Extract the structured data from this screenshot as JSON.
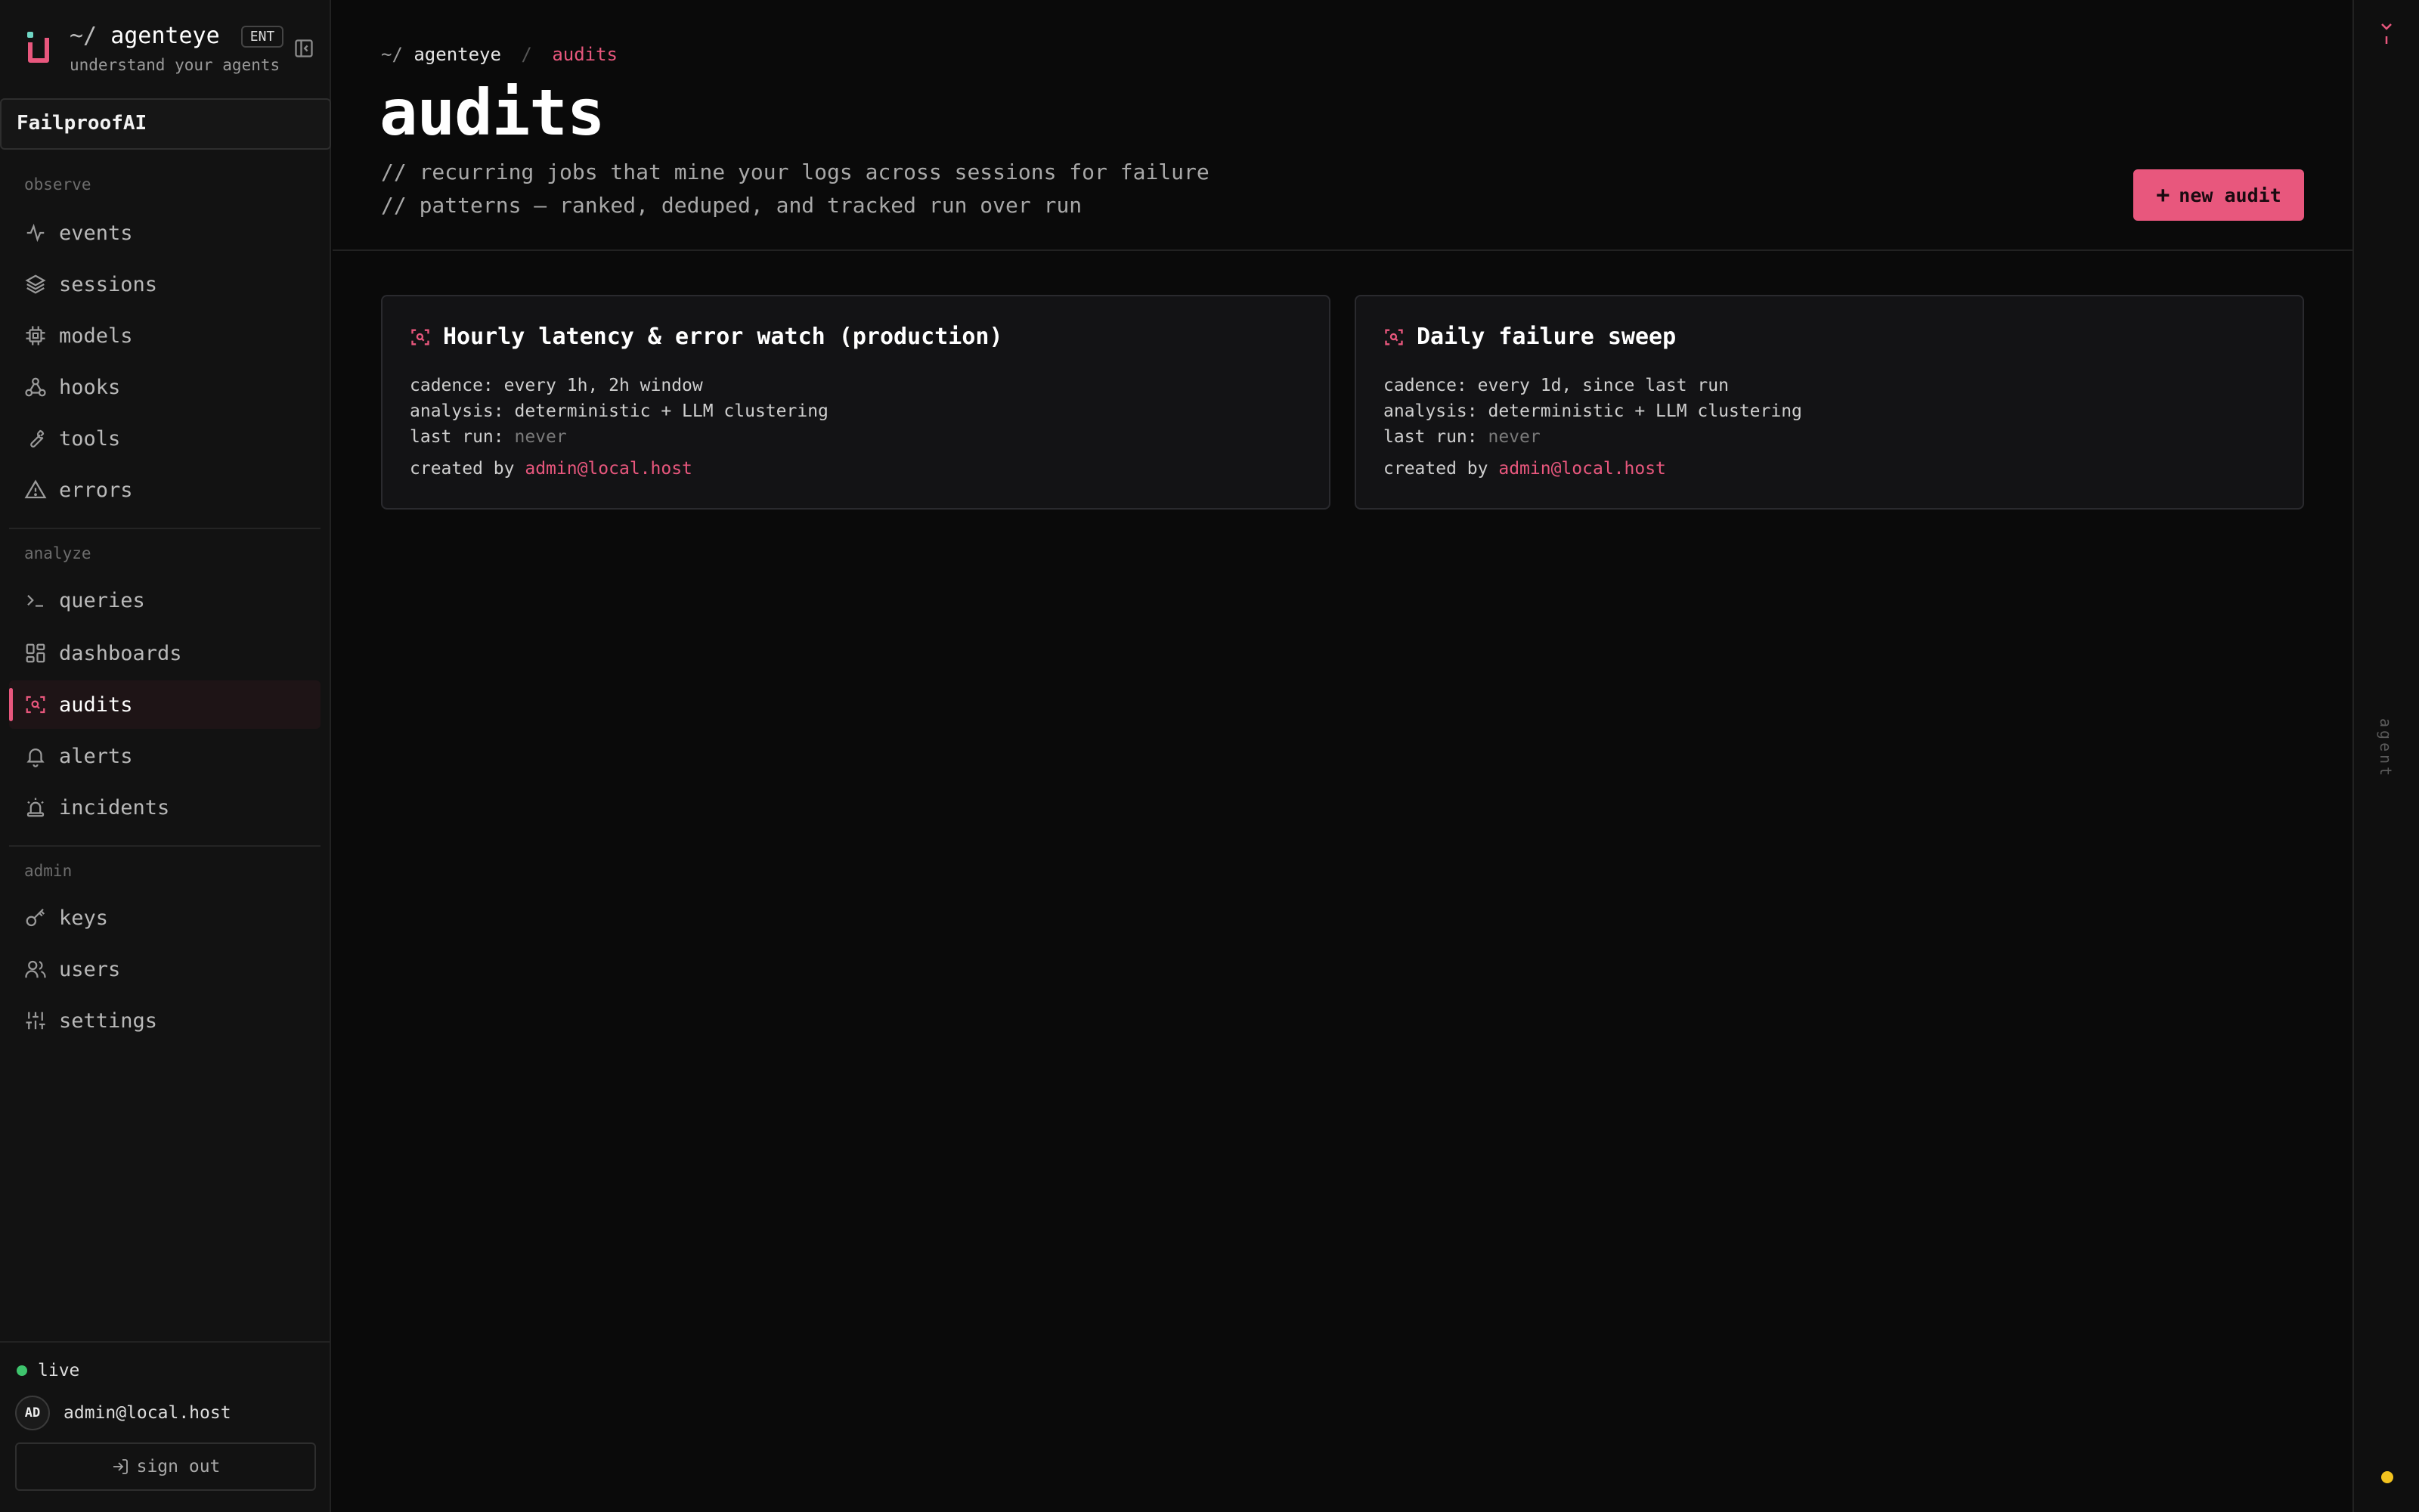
{
  "brand": {
    "prefix": "~/",
    "name": "agenteye",
    "badge": "ENT",
    "tagline": "understand your agents",
    "accent": "#e8577d"
  },
  "org": {
    "name": "FailproofAI"
  },
  "sidebar": {
    "sections": [
      {
        "label": "observe",
        "items": [
          {
            "label": "events",
            "icon": "activity-icon"
          },
          {
            "label": "sessions",
            "icon": "layers-icon"
          },
          {
            "label": "models",
            "icon": "cpu-icon"
          },
          {
            "label": "hooks",
            "icon": "webhook-icon"
          },
          {
            "label": "tools",
            "icon": "wrench-icon"
          },
          {
            "label": "errors",
            "icon": "warning-icon"
          }
        ]
      },
      {
        "label": "analyze",
        "items": [
          {
            "label": "queries",
            "icon": "terminal-icon"
          },
          {
            "label": "dashboards",
            "icon": "grid-icon"
          },
          {
            "label": "audits",
            "icon": "scan-icon",
            "active": true
          },
          {
            "label": "alerts",
            "icon": "bell-icon"
          },
          {
            "label": "incidents",
            "icon": "siren-icon"
          }
        ]
      },
      {
        "label": "admin",
        "items": [
          {
            "label": "keys",
            "icon": "key-icon"
          },
          {
            "label": "users",
            "icon": "users-icon"
          },
          {
            "label": "settings",
            "icon": "sliders-icon"
          }
        ]
      }
    ],
    "status": {
      "label": "live",
      "color": "#3ec46d"
    },
    "user": {
      "initials": "AD",
      "email": "admin@local.host"
    },
    "signout_label": "sign out"
  },
  "breadcrumb": {
    "prefix": "~/",
    "root": "agenteye",
    "separator": "/",
    "current": "audits"
  },
  "page": {
    "title": "audits",
    "description": [
      "// recurring jobs that mine your logs across sessions for failure",
      "// patterns — ranked, deduped, and tracked run over run"
    ],
    "new_button": {
      "plus": "+",
      "label": "new audit"
    }
  },
  "audits": [
    {
      "title": "Hourly latency & error watch (production)",
      "cadence_label": "cadence:",
      "cadence": "every 1h, 2h window",
      "analysis_label": "analysis:",
      "analysis": "deterministic + LLM clustering",
      "last_run_label": "last run:",
      "last_run": "never",
      "created_label": "created by",
      "created_by": "admin@local.host"
    },
    {
      "title": "Daily failure sweep",
      "cadence_label": "cadence:",
      "cadence": "every 1d, since last run",
      "analysis_label": "analysis:",
      "analysis": "deterministic + LLM clustering",
      "last_run_label": "last run:",
      "last_run": "never",
      "created_label": "created by",
      "created_by": "admin@local.host"
    }
  ],
  "rail": {
    "label": "agent",
    "indicator_color": "#f3c31f"
  }
}
